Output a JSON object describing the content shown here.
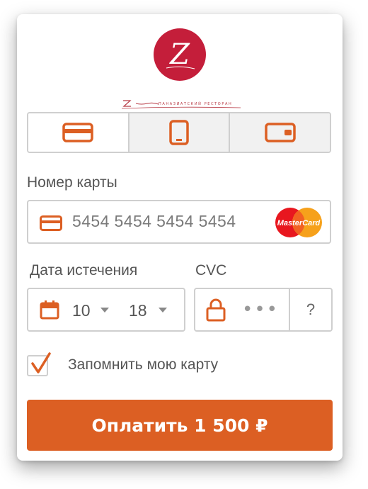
{
  "colors": {
    "accent": "#dc5f23",
    "brand_red": "#c41e3a",
    "border": "#cfcfcf",
    "tab_inactive_bg": "#f1f1f1"
  },
  "logo": {
    "letter": "Z",
    "tagline": "ПАНАЗИАТСКИЙ РЕСТОРАН"
  },
  "payment_tabs": [
    {
      "icon": "credit-card-icon",
      "selected": true
    },
    {
      "icon": "mobile-phone-icon",
      "selected": false
    },
    {
      "icon": "wallet-icon",
      "selected": false
    }
  ],
  "card_number": {
    "label": "Номер карты",
    "value": "5454 5454 5454 5454",
    "brand_icon": "mastercard-logo",
    "brand_text": "MasterCard"
  },
  "expiry": {
    "label": "Дата истечения",
    "month": "10",
    "year": "18"
  },
  "cvc": {
    "label": "CVC",
    "masked_value": "•••",
    "help": "?"
  },
  "remember": {
    "label": "Запомнить мою карту",
    "checked": true
  },
  "pay_button": {
    "label": "Оплатить 1 500 ₽"
  }
}
